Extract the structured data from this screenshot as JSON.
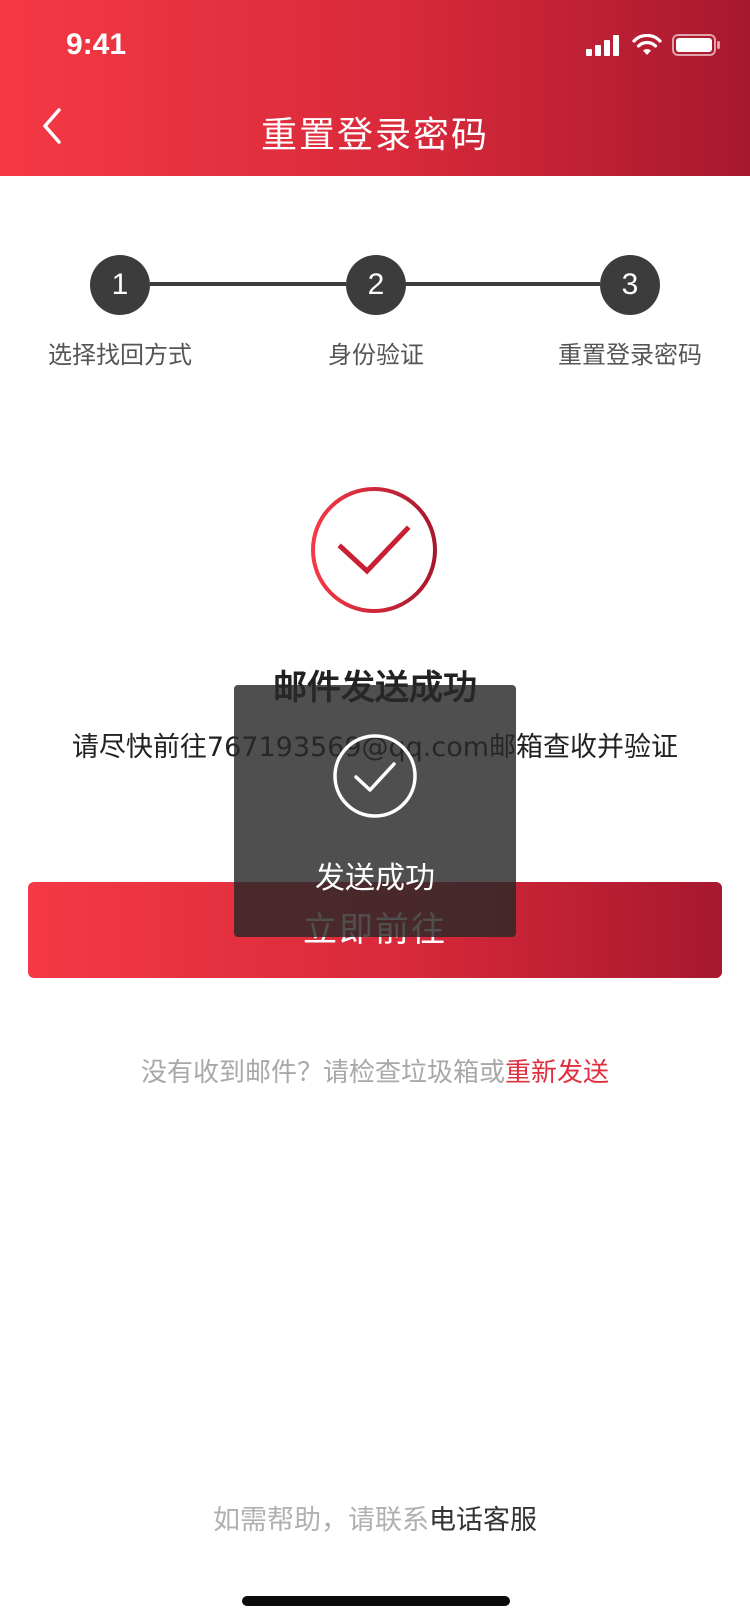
{
  "status_bar": {
    "time": "9:41",
    "icons": [
      "signal-icon",
      "wifi-icon",
      "battery-icon"
    ]
  },
  "nav": {
    "back_icon": "chevron-left-icon",
    "title": "重置登录密码"
  },
  "steps": [
    {
      "number": "1",
      "label": "选择找回方式"
    },
    {
      "number": "2",
      "label": "身份验证"
    },
    {
      "number": "3",
      "label": "重置登录密码"
    }
  ],
  "result": {
    "icon": "check-circle-icon",
    "title": "邮件发送成功",
    "description": "请尽快前往767193569@qq.com邮箱查收并验证"
  },
  "primary_button": {
    "label": "立即前往"
  },
  "resend": {
    "prefix": "没有收到邮件？请检查垃圾箱或",
    "link": "重新发送"
  },
  "toast": {
    "icon": "check-circle-icon",
    "text": "发送成功"
  },
  "help": {
    "prefix": "如需帮助，请联系",
    "link": "电话客服"
  },
  "colors": {
    "brand_start": "#f53945",
    "brand_end": "#a7182e",
    "link_red": "#e02f3f",
    "step_dark": "#3c3c3c"
  }
}
